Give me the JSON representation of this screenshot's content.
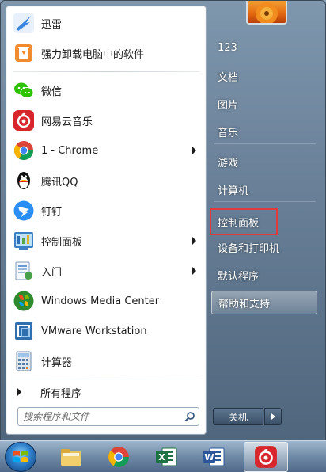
{
  "start_menu": {
    "programs": [
      {
        "label": "迅雷",
        "icon": "thunder-bird-icon",
        "has_submenu": false
      },
      {
        "label": "强力卸载电脑中的软件",
        "icon": "recycle-bin-icon",
        "has_submenu": false
      },
      {
        "label": "微信",
        "icon": "wechat-icon",
        "has_submenu": false
      },
      {
        "label": "网易云音乐",
        "icon": "netease-music-icon",
        "has_submenu": false
      },
      {
        "label": "1 - Chrome",
        "icon": "chrome-icon",
        "has_submenu": true
      },
      {
        "label": "腾讯QQ",
        "icon": "qq-penguin-icon",
        "has_submenu": false
      },
      {
        "label": "钉钉",
        "icon": "dingtalk-icon",
        "has_submenu": false
      },
      {
        "label": "控制面板",
        "icon": "control-panel-icon",
        "has_submenu": true
      },
      {
        "label": "入门",
        "icon": "getting-started-icon",
        "has_submenu": true
      },
      {
        "label": "Windows Media Center",
        "icon": "media-center-icon",
        "has_submenu": false
      },
      {
        "label": "VMware Workstation",
        "icon": "vmware-icon",
        "has_submenu": false
      },
      {
        "label": "计算器",
        "icon": "calculator-icon",
        "has_submenu": false
      }
    ],
    "all_programs_label": "所有程序",
    "search_placeholder": "搜索程序和文件",
    "right_items": [
      {
        "label": "123"
      },
      {
        "label": "文档"
      },
      {
        "label": "图片"
      },
      {
        "label": "音乐"
      },
      {
        "label": "游戏"
      },
      {
        "label": "计算机"
      },
      {
        "label": "控制面板",
        "state": "highlighted-red-box"
      },
      {
        "label": "设备和打印机"
      },
      {
        "label": "默认程序"
      },
      {
        "label": "帮助和支持",
        "state": "hover"
      }
    ],
    "shutdown_label": "关机"
  },
  "taskbar": {
    "items": [
      {
        "icon": "windows-start-orb-icon"
      },
      {
        "icon": "file-explorer-icon"
      },
      {
        "icon": "chrome-icon"
      },
      {
        "icon": "excel-icon",
        "letter": "X"
      },
      {
        "icon": "word-icon",
        "letter": "W"
      },
      {
        "icon": "netease-music-icon",
        "state": "active"
      }
    ]
  },
  "colors": {
    "highlight_box": "#e23b3b",
    "netease_red": "#d8262d",
    "chrome_red": "#db4437",
    "chrome_yellow": "#f4b400",
    "chrome_green": "#0f9d58",
    "chrome_blue": "#4285f4",
    "excel_green": "#1f7244",
    "word_blue": "#2b579a"
  }
}
